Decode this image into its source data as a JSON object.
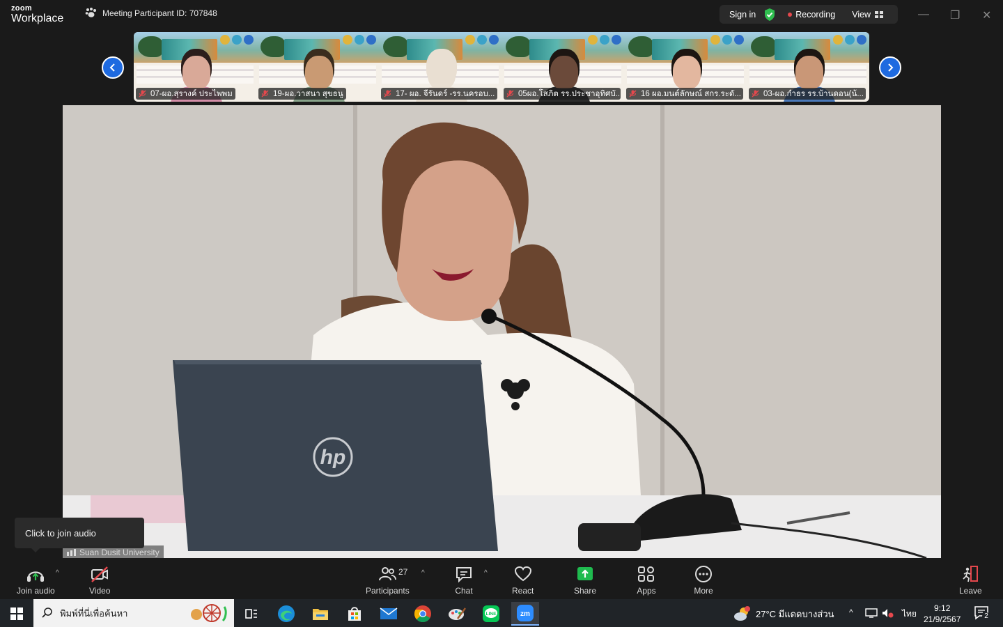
{
  "titlebar": {
    "logo_small": "zoom",
    "logo_big": "Workplace",
    "meeting_id": "Meeting Participant ID: 707848",
    "sign_in": "Sign in",
    "recording": "Recording",
    "view": "View"
  },
  "participants_strip": [
    {
      "name": "07-ผอ.สุรางค์ ประไพพม",
      "skin": "#d9a998",
      "hair": "#2b1e1c",
      "shirt": "#d48ea8"
    },
    {
      "name": "19-ผอ.วาสนา สุขธนู",
      "skin": "#c99a73",
      "hair": "#3a2d1e",
      "shirt": "#87a38a"
    },
    {
      "name": "17- ผอ. จีรันดร์ -รร.นครอบ...",
      "skin": "#e9dfd2",
      "hair": "#e9dfd2",
      "shirt": "#e9dfd2"
    },
    {
      "name": "05ผอ.โสภิต  รร.ประชาอุทิศบั...",
      "skin": "#6b4a3a",
      "hair": "#1d1612",
      "shirt": "#2b2b2b"
    },
    {
      "name": "16 ผอ.มนต์ลักษณ์ สกร.ระดั...",
      "skin": "#e3b79f",
      "hair": "#1d1612",
      "shirt": "#f4f0ec"
    },
    {
      "name": "03-ผอ.กำธร รร.บ้านดอน(น้...",
      "skin": "#c99777",
      "hair": "#1d1612",
      "shirt": "#4a78b8"
    }
  ],
  "main_video": {
    "label": "Suan Dusit University"
  },
  "tooltip": "Click to join audio",
  "toolbar": {
    "join_audio": "Join audio",
    "video": "Video",
    "participants": "Participants",
    "participants_count": "27",
    "chat": "Chat",
    "react": "React",
    "share": "Share",
    "apps": "Apps",
    "more": "More",
    "leave": "Leave"
  },
  "taskbar": {
    "search_placeholder": "พิมพ์ที่นี่เพื่อค้นหา",
    "weather": "27°C  มีแดดบางส่วน",
    "weather_badge": "1",
    "lang": "ไทย",
    "time": "9:12",
    "date": "21/9/2567",
    "notifications": "2"
  },
  "colors": {
    "accent_blue": "#1e6ae0",
    "share_green": "#1fbb4f",
    "muted_red": "#e5484d",
    "shield_green": "#2fbf4f"
  }
}
